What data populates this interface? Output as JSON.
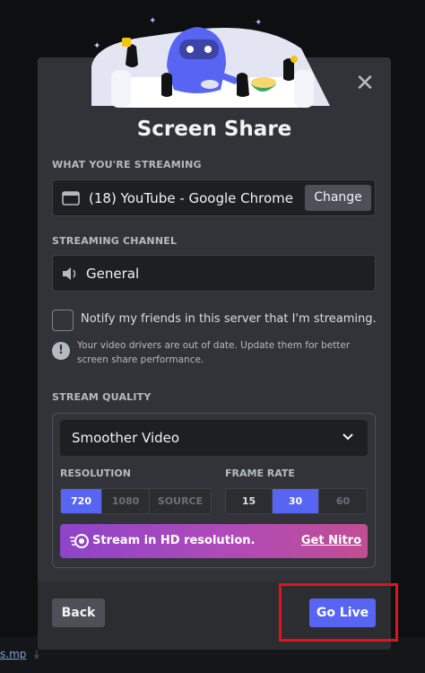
{
  "dialog": {
    "title": "Screen Share",
    "close_glyph": "✕"
  },
  "streaming": {
    "label": "WHAT YOU'RE STREAMING",
    "source_icon": "window-icon",
    "source": "(18) YouTube - Google Chrome",
    "change_label": "Change"
  },
  "channel": {
    "label": "STREAMING CHANNEL",
    "icon": "speaker-icon",
    "name": "General"
  },
  "notify": {
    "checked": false,
    "text": "Notify my friends in this server that I'm streaming."
  },
  "warning": {
    "glyph": "!",
    "text": "Your video drivers are out of date. Update them for better screen share performance."
  },
  "quality": {
    "label": "STREAM QUALITY",
    "selected": "Smoother Video",
    "resolution_label": "RESOLUTION",
    "resolution_options": [
      "720",
      "1080",
      "SOURCE"
    ],
    "resolution_selected": "720",
    "framerate_label": "FRAME RATE",
    "framerate_options": [
      "15",
      "30",
      "60"
    ],
    "framerate_selected": "30"
  },
  "nitro": {
    "text": "Stream in HD resolution.",
    "link": "Get Nitro"
  },
  "footer": {
    "back_label": "Back",
    "go_live_label": "Go Live"
  },
  "background": {
    "file_fragment": "s.mp",
    "download_glyph": "⤓"
  },
  "colors": {
    "brand": "#5865f2",
    "annotation": "#e0141e",
    "modal": "#313338"
  }
}
